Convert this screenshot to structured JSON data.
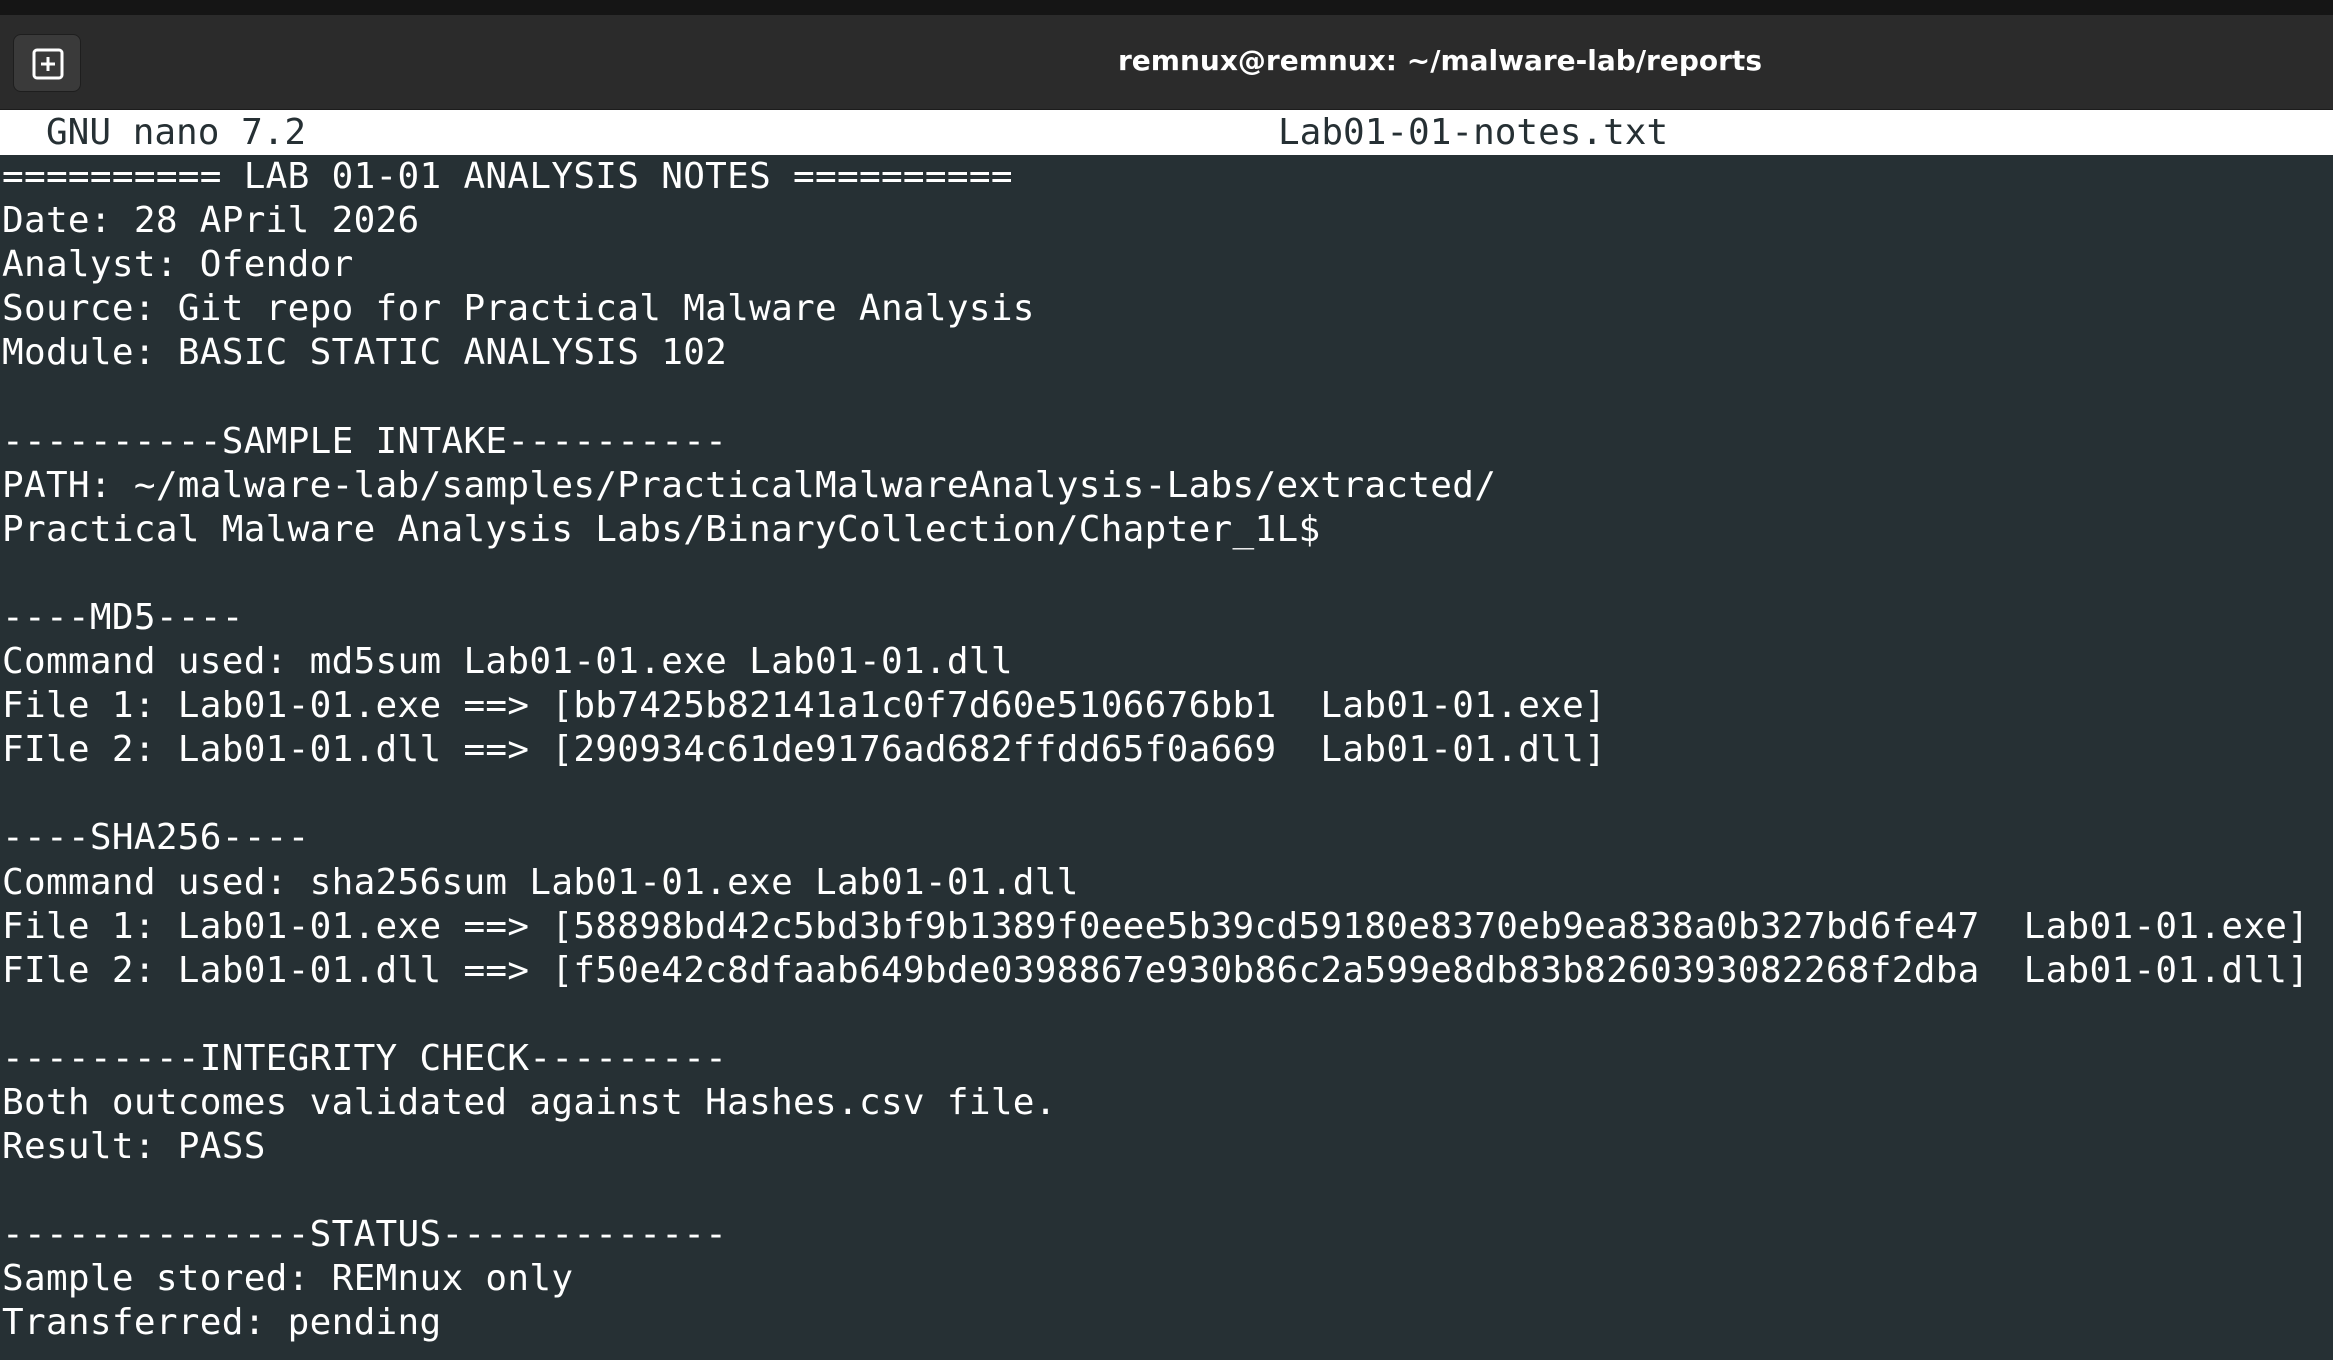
{
  "window": {
    "title": "remnux@remnux: ~/malware-lab/reports",
    "new_tab_icon": "plus-square-icon"
  },
  "nano": {
    "version": "GNU nano 7.2",
    "filename": "Lab01-01-notes.txt"
  },
  "document": {
    "lines": [
      "========== LAB 01-01 ANALYSIS NOTES ==========",
      "Date: 28 APril 2026",
      "Analyst: Ofendor",
      "Source: Git repo for Practical Malware Analysis",
      "Module: BASIC STATIC ANALYSIS 102",
      "",
      "----------SAMPLE INTAKE----------",
      "PATH: ~/malware-lab/samples/PracticalMalwareAnalysis-Labs/extracted/",
      "Practical Malware Analysis Labs/BinaryCollection/Chapter_1L$",
      "",
      "----MD5----",
      "Command used: md5sum Lab01-01.exe Lab01-01.dll",
      "File 1: Lab01-01.exe ==> [bb7425b82141a1c0f7d60e5106676bb1  Lab01-01.exe]",
      "FIle 2: Lab01-01.dll ==> [290934c61de9176ad682ffdd65f0a669  Lab01-01.dll]",
      "",
      "----SHA256----",
      "Command used: sha256sum Lab01-01.exe Lab01-01.dll",
      "File 1: Lab01-01.exe ==> [58898bd42c5bd3bf9b1389f0eee5b39cd59180e8370eb9ea838a0b327bd6fe47  Lab01-01.exe]",
      "FIle 2: Lab01-01.dll ==> [f50e42c8dfaab649bde0398867e930b86c2a599e8db83b8260393082268f2dba  Lab01-01.dll]",
      "",
      "---------INTEGRITY CHECK---------",
      "Both outcomes validated against Hashes.csv file.",
      "Result: PASS",
      "",
      "--------------STATUS-------------",
      "Sample stored: REMnux only",
      "Transferred: pending"
    ]
  }
}
